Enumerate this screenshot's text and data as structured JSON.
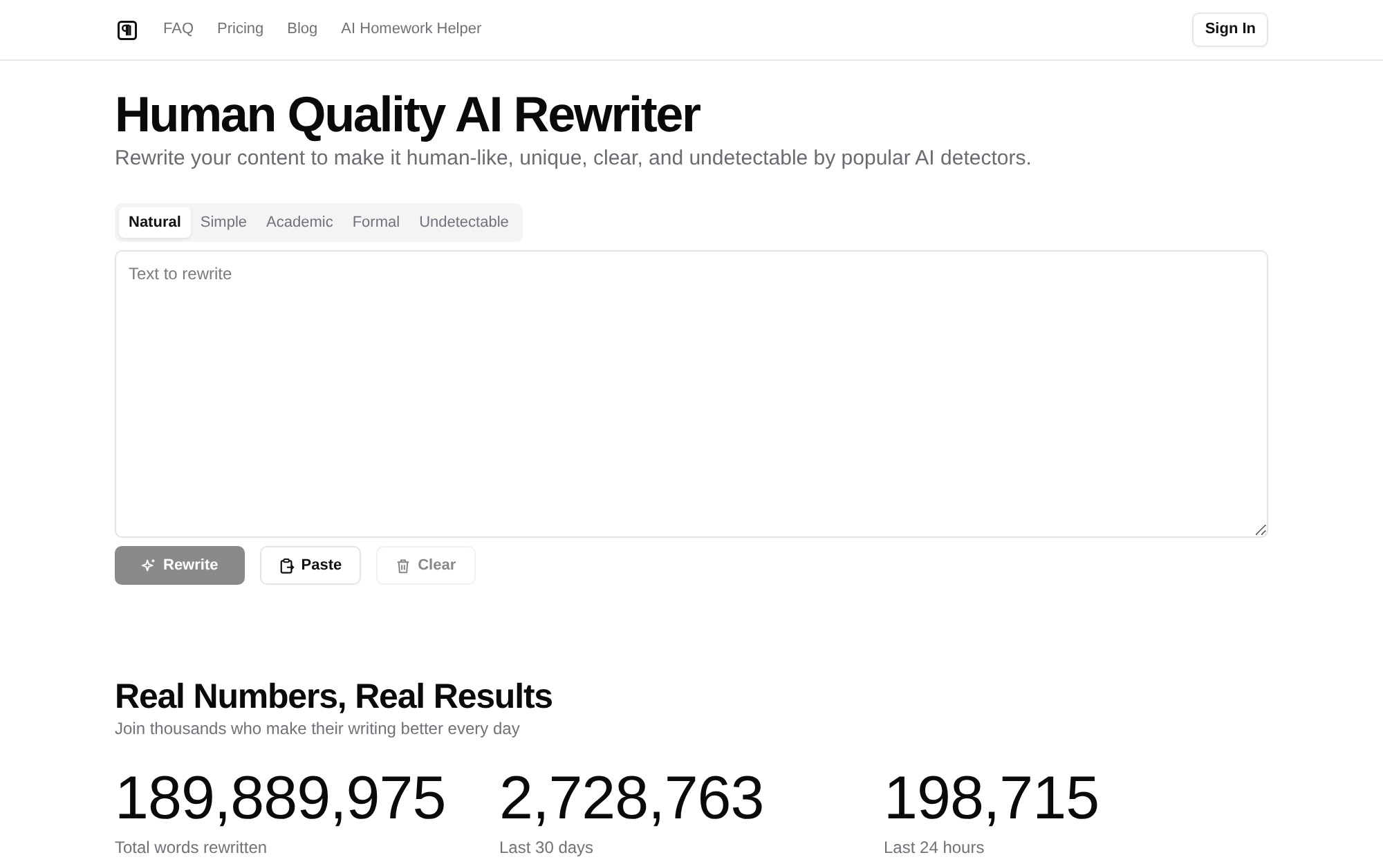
{
  "nav": {
    "links": [
      "FAQ",
      "Pricing",
      "Blog",
      "AI Homework Helper"
    ],
    "sign_in": "Sign In"
  },
  "hero": {
    "title": "Human Quality AI Rewriter",
    "subtitle": "Rewrite your content to make it human-like, unique, clear, and undetectable by popular AI detectors."
  },
  "modes": [
    {
      "label": "Natural",
      "selected": true
    },
    {
      "label": "Simple",
      "selected": false
    },
    {
      "label": "Academic",
      "selected": false
    },
    {
      "label": "Formal",
      "selected": false
    },
    {
      "label": "Undetectable",
      "selected": false
    }
  ],
  "editor": {
    "placeholder": "Text to rewrite"
  },
  "actions": [
    {
      "label": "Rewrite",
      "kind": "primary",
      "disabled": true
    },
    {
      "label": "Paste",
      "kind": "outline",
      "disabled": false
    },
    {
      "label": "Clear",
      "kind": "outline",
      "disabled": true
    }
  ],
  "stats": {
    "title": "Real Numbers, Real Results",
    "subtitle": "Join thousands who make their writing better every day",
    "items": [
      {
        "value": "189,889,975",
        "label": "Total words rewritten"
      },
      {
        "value": "2,728,763",
        "label": "Last 30 days"
      },
      {
        "value": "198,715",
        "label": "Last 24 hours"
      }
    ]
  }
}
